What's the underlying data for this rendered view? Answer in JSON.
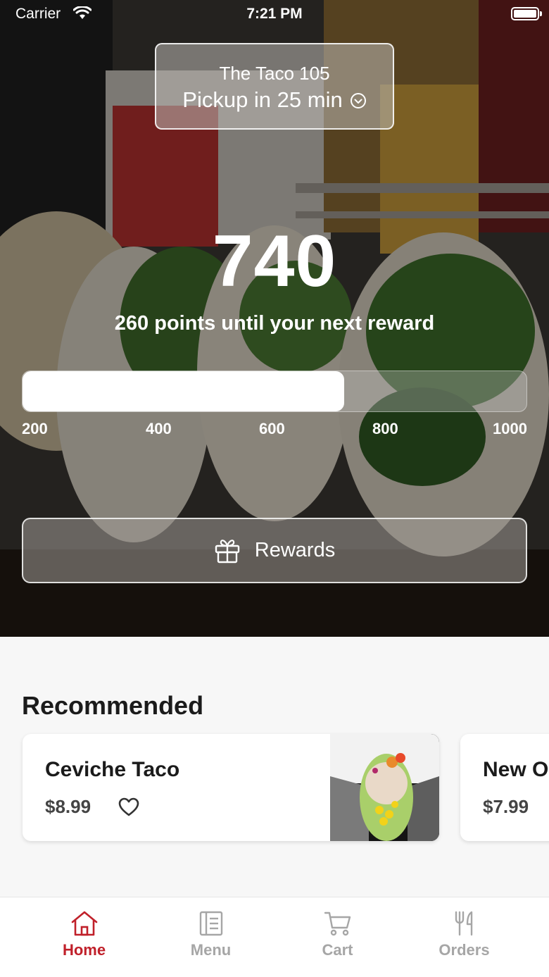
{
  "status_bar": {
    "carrier": "Carrier",
    "time": "7:21 PM"
  },
  "location": {
    "store_name": "The Taco 105",
    "pickup": "Pickup in 25 min"
  },
  "rewards": {
    "points": "740",
    "subtitle": "260 points until your next reward",
    "progress_fraction": 0.638,
    "ticks": [
      "200",
      "400",
      "600",
      "800",
      "1000"
    ],
    "button_label": "Rewards"
  },
  "recommended": {
    "title": "Recommended",
    "items": [
      {
        "name": "Ceviche Taco",
        "price": "$8.99"
      },
      {
        "name": "New O",
        "price": "$7.99"
      }
    ]
  },
  "tabs": [
    {
      "label": "Home",
      "icon": "home-icon",
      "active": true
    },
    {
      "label": "Menu",
      "icon": "menu-icon",
      "active": false
    },
    {
      "label": "Cart",
      "icon": "cart-icon",
      "active": false
    },
    {
      "label": "Orders",
      "icon": "fork-knife-icon",
      "active": false
    }
  ],
  "colors": {
    "accent": "#c0202a",
    "inactive_tab": "#a6a6a6"
  }
}
